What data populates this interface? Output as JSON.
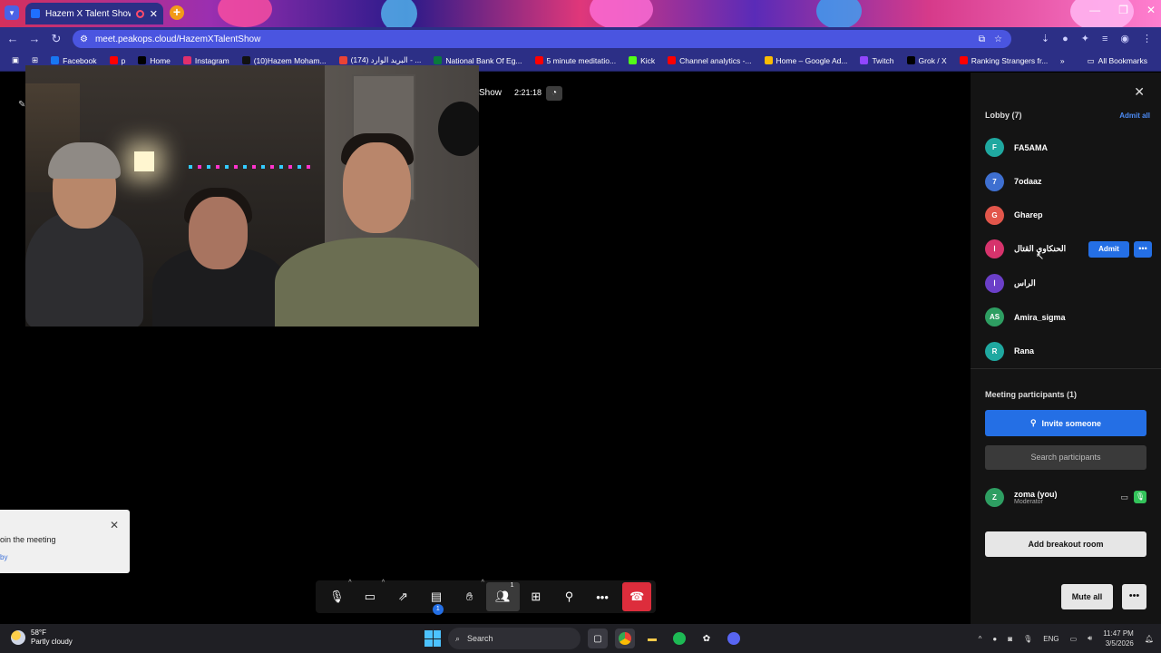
{
  "browser": {
    "tab_title": "Hazem X Talent Show | Jitsi",
    "url": "meet.peakops.cloud/HazemXTalentShow",
    "bookmarks": [
      {
        "label": "Facebook",
        "color": "#1877f2"
      },
      {
        "label": "p",
        "color": "#ff0000"
      },
      {
        "label": "Home",
        "color": "#000000"
      },
      {
        "label": "Instagram",
        "color": "#e1306c"
      },
      {
        "label": "(10)Hazem Moham...",
        "color": "#111111"
      },
      {
        "label": "(174) البريد الوارد - ...",
        "color": "#ea4335"
      },
      {
        "label": "National Bank Of Eg...",
        "color": "#0a7a3c"
      },
      {
        "label": "5 minute meditatio...",
        "color": "#ff0000"
      },
      {
        "label": "Kick",
        "color": "#53fc18"
      },
      {
        "label": "Channel analytics -...",
        "color": "#ff0000"
      },
      {
        "label": "Home – Google Ad...",
        "color": "#fbbc04"
      },
      {
        "label": "Twitch",
        "color": "#9146ff"
      },
      {
        "label": "Grok / X",
        "color": "#000000"
      },
      {
        "label": "Ranking Strangers fr...",
        "color": "#ff0000"
      }
    ],
    "all_bookmarks": "All Bookmarks"
  },
  "meeting": {
    "title_fragment": "Show",
    "timer": "2:21:18",
    "notice_text": "oin the meeting",
    "notice_link": "by",
    "chat_badge": "1",
    "participants_badge": "1"
  },
  "panel": {
    "lobby_title": "Lobby (7)",
    "admit_all": "Admit all",
    "lobby": [
      {
        "initial": "F",
        "name": "FA5AMA",
        "color": "#1fa8a0"
      },
      {
        "initial": "7",
        "name": "7odaaz",
        "color": "#3e6fd0"
      },
      {
        "initial": "G",
        "name": "Gharep",
        "color": "#e2564b"
      },
      {
        "initial": "ا",
        "name": "الحنكاوي القتال",
        "color": "#d6336c"
      },
      {
        "initial": "ا",
        "name": "الراس",
        "color": "#6b3fc8"
      },
      {
        "initial": "AS",
        "name": "Amira_sigma",
        "color": "#2e9e62"
      },
      {
        "initial": "R",
        "name": "Rana",
        "color": "#1fa8a0"
      }
    ],
    "admit_label": "Admit",
    "participants_title": "Meeting participants (1)",
    "invite_label": "Invite someone",
    "search_placeholder": "Search participants",
    "me": {
      "initial": "Z",
      "name": "zoma (you)",
      "role": "Moderator",
      "color": "#2e9e62"
    },
    "breakout_label": "Add breakout room",
    "mute_all_label": "Mute all"
  },
  "taskbar": {
    "temp": "58°F",
    "weather": "Partly cloudy",
    "search": "Search",
    "lang": "ENG",
    "time": "11:47 PM",
    "date": "3/5/2026"
  }
}
